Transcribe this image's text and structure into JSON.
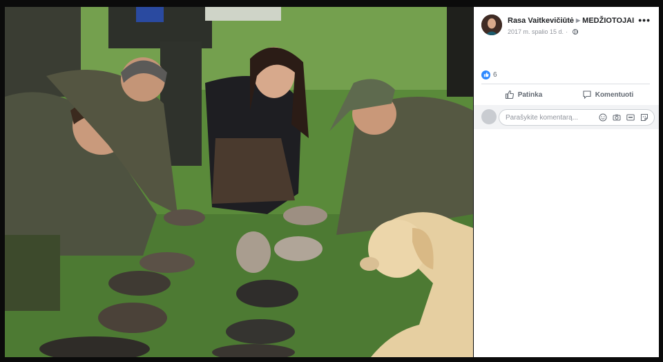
{
  "post": {
    "author": "Rasa Vaitkevičiūtė",
    "group": "MEDŽIOTOJAI",
    "date": "2017 m. spalio 15 d.",
    "more_icon": "more-dots-icon",
    "privacy_icon": "globe-icon"
  },
  "reactions": {
    "count": "6",
    "icon": "thumbs-up-icon"
  },
  "actions": {
    "like_label": "Patinka",
    "comment_label": "Komentuoti"
  },
  "comment": {
    "placeholder": "Parašykite komentarą...",
    "icons": [
      "emoji-icon",
      "camera-icon",
      "gif-icon",
      "sticker-icon"
    ]
  },
  "colors": {
    "accent": "#2d88ff",
    "muted": "#606770",
    "background": "#0b0b0b"
  }
}
